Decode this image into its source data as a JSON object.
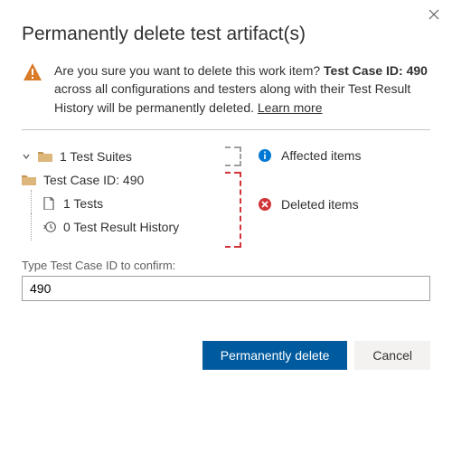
{
  "dialog": {
    "title": "Permanently delete test artifact(s)",
    "close_label": "Close"
  },
  "warning": {
    "prefix": "Are you sure you want to delete this work item? ",
    "bold_id": "Test Case ID: 490",
    "suffix": " across all configurations and testers along with their Test Result History will be permanently deleted. ",
    "learn_more": "Learn more"
  },
  "tree": {
    "suites_label": "1 Test Suites",
    "testcase_label": "Test Case ID: 490",
    "tests_label": "1 Tests",
    "history_label": "0 Test Result History"
  },
  "legend": {
    "affected": "Affected items",
    "deleted": "Deleted items"
  },
  "confirm": {
    "prompt": "Type Test Case ID to confirm:",
    "value": "490"
  },
  "buttons": {
    "primary": "Permanently delete",
    "cancel": "Cancel"
  },
  "colors": {
    "primary": "#005a9e",
    "danger": "#d13438",
    "info": "#0078d4",
    "warn": "#d97b29"
  }
}
